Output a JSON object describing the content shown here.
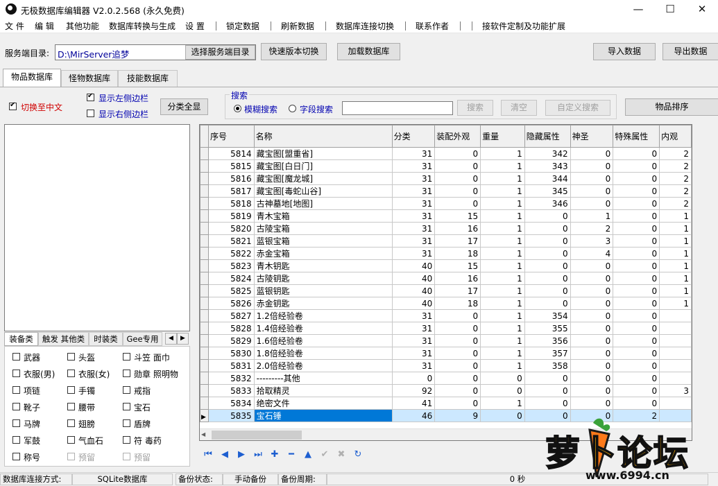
{
  "window": {
    "title": "无极数据库编辑器 V2.0.2.568 (永久免费)",
    "minimize": "—",
    "maximize": "☐",
    "close": "✕"
  },
  "menu": [
    "文 件",
    "编 辑",
    "其他功能",
    "数据库转换与生成",
    "设 置",
    "锁定数据",
    "刷新数据",
    "数据库连接切换",
    "联系作者",
    "接软件定制及功能扩展"
  ],
  "toolbar": {
    "server_label": "服务端目录:",
    "server_path": "D:\\MirServer追梦",
    "select_dir": "选择服务端目录",
    "quick_switch": "快速版本切换",
    "load_db": "加载数据库",
    "import": "导入数据",
    "export": "导出数据"
  },
  "tabs": [
    "物品数据库",
    "怪物数据库",
    "技能数据库"
  ],
  "options": {
    "switch_cn": "切换至中文",
    "show_left": "显示左侧边栏",
    "show_right": "显示右侧边栏",
    "expand_all": "分类全显",
    "sort_items": "物品排序"
  },
  "search": {
    "group_title": "搜索",
    "fuzzy": "模糊搜索",
    "field": "字段搜索",
    "search_btn": "搜索",
    "clear_btn": "清空",
    "custom_btn": "自定义搜索",
    "value": ""
  },
  "category_tabs": [
    "装备类",
    "触发 其他类",
    "时装类",
    "Gee专用"
  ],
  "categories": [
    [
      {
        "label": "武器"
      },
      {
        "label": "头盔"
      },
      {
        "label": "斗笠 面巾"
      }
    ],
    [
      {
        "label": "衣服(男)"
      },
      {
        "label": "衣服(女)"
      },
      {
        "label": "勋章 照明物"
      }
    ],
    [
      {
        "label": "项链"
      },
      {
        "label": "手镯"
      },
      {
        "label": "戒指"
      }
    ],
    [
      {
        "label": "靴子"
      },
      {
        "label": "腰带"
      },
      {
        "label": "宝石"
      }
    ],
    [
      {
        "label": "马牌"
      },
      {
        "label": "翅膀"
      },
      {
        "label": "盾牌"
      }
    ],
    [
      {
        "label": "军鼓"
      },
      {
        "label": "气血石"
      },
      {
        "label": "符 毒药"
      }
    ],
    [
      {
        "label": "称号"
      },
      {
        "label": "预留",
        "disabled": true
      },
      {
        "label": "预留",
        "disabled": true
      }
    ]
  ],
  "grid": {
    "columns": [
      "序号",
      "名称",
      "分类",
      "装配外观",
      "重量",
      "隐藏属性",
      "神圣",
      "特殊属性",
      "内观"
    ],
    "rows": [
      [
        "5814",
        "藏宝图[盟重省]",
        "31",
        "0",
        "1",
        "342",
        "0",
        "0",
        "2"
      ],
      [
        "5815",
        "藏宝图[白日门]",
        "31",
        "0",
        "1",
        "343",
        "0",
        "0",
        "2"
      ],
      [
        "5816",
        "藏宝图[魔龙城]",
        "31",
        "0",
        "1",
        "344",
        "0",
        "0",
        "2"
      ],
      [
        "5817",
        "藏宝图[毒蛇山谷]",
        "31",
        "0",
        "1",
        "345",
        "0",
        "0",
        "2"
      ],
      [
        "5818",
        "古神墓地[地图]",
        "31",
        "0",
        "1",
        "346",
        "0",
        "0",
        "2"
      ],
      [
        "5819",
        "青木宝箱",
        "31",
        "15",
        "1",
        "0",
        "1",
        "0",
        "1"
      ],
      [
        "5820",
        "古陵宝箱",
        "31",
        "16",
        "1",
        "0",
        "2",
        "0",
        "1"
      ],
      [
        "5821",
        "蓝银宝箱",
        "31",
        "17",
        "1",
        "0",
        "3",
        "0",
        "1"
      ],
      [
        "5822",
        "赤金宝箱",
        "31",
        "18",
        "1",
        "0",
        "4",
        "0",
        "1"
      ],
      [
        "5823",
        "青木钥匙",
        "40",
        "15",
        "1",
        "0",
        "0",
        "0",
        "1"
      ],
      [
        "5824",
        "古陵钥匙",
        "40",
        "16",
        "1",
        "0",
        "0",
        "0",
        "1"
      ],
      [
        "5825",
        "蓝银钥匙",
        "40",
        "17",
        "1",
        "0",
        "0",
        "0",
        "1"
      ],
      [
        "5826",
        "赤金钥匙",
        "40",
        "18",
        "1",
        "0",
        "0",
        "0",
        "1"
      ],
      [
        "5827",
        "1.2倍经验卷",
        "31",
        "0",
        "1",
        "354",
        "0",
        "0",
        ""
      ],
      [
        "5828",
        "1.4倍经验卷",
        "31",
        "0",
        "1",
        "355",
        "0",
        "0",
        ""
      ],
      [
        "5829",
        "1.6倍经验卷",
        "31",
        "0",
        "1",
        "356",
        "0",
        "0",
        ""
      ],
      [
        "5830",
        "1.8倍经验卷",
        "31",
        "0",
        "1",
        "357",
        "0",
        "0",
        ""
      ],
      [
        "5831",
        "2.0倍经验卷",
        "31",
        "0",
        "1",
        "358",
        "0",
        "0",
        ""
      ],
      [
        "5832",
        "---------其他",
        "0",
        "0",
        "0",
        "0",
        "0",
        "0",
        ""
      ],
      [
        "5833",
        "拾取精灵",
        "92",
        "0",
        "0",
        "0",
        "0",
        "0",
        "3"
      ],
      [
        "5834",
        "绝密文件",
        "41",
        "0",
        "1",
        "0",
        "0",
        "0",
        ""
      ],
      [
        "5835",
        "宝石锤",
        "46",
        "9",
        "0",
        "0",
        "0",
        "2",
        ""
      ]
    ],
    "selected_index": 21
  },
  "navigator": [
    {
      "name": "nav-first-icon",
      "glyph": "⏮",
      "color": "#1e5fd0"
    },
    {
      "name": "nav-prior-icon",
      "glyph": "◀",
      "color": "#1e5fd0"
    },
    {
      "name": "nav-next-icon",
      "glyph": "▶",
      "color": "#1e5fd0"
    },
    {
      "name": "nav-last-icon",
      "glyph": "⏭",
      "color": "#1e5fd0"
    },
    {
      "name": "nav-insert-icon",
      "glyph": "✚",
      "color": "#1e5fd0"
    },
    {
      "name": "nav-delete-icon",
      "glyph": "━",
      "color": "#1e5fd0"
    },
    {
      "name": "nav-edit-icon",
      "glyph": "▲",
      "color": "#1e5fd0"
    },
    {
      "name": "nav-post-icon",
      "glyph": "✔",
      "color": "#b0b0b0"
    },
    {
      "name": "nav-cancel-icon",
      "glyph": "✖",
      "color": "#b0b0b0"
    },
    {
      "name": "nav-refresh-icon",
      "glyph": "↻",
      "color": "#1e5fd0"
    }
  ],
  "status": {
    "conn_label": "数据库连接方式:",
    "conn_value": "SQLite数据库",
    "backup_label": "备份状态:",
    "backup_value": "手动备份",
    "period_label": "备份周期:",
    "period_value": "0 秒"
  },
  "watermark": {
    "text": "萝卜论坛",
    "url": "www.6994.cn"
  }
}
